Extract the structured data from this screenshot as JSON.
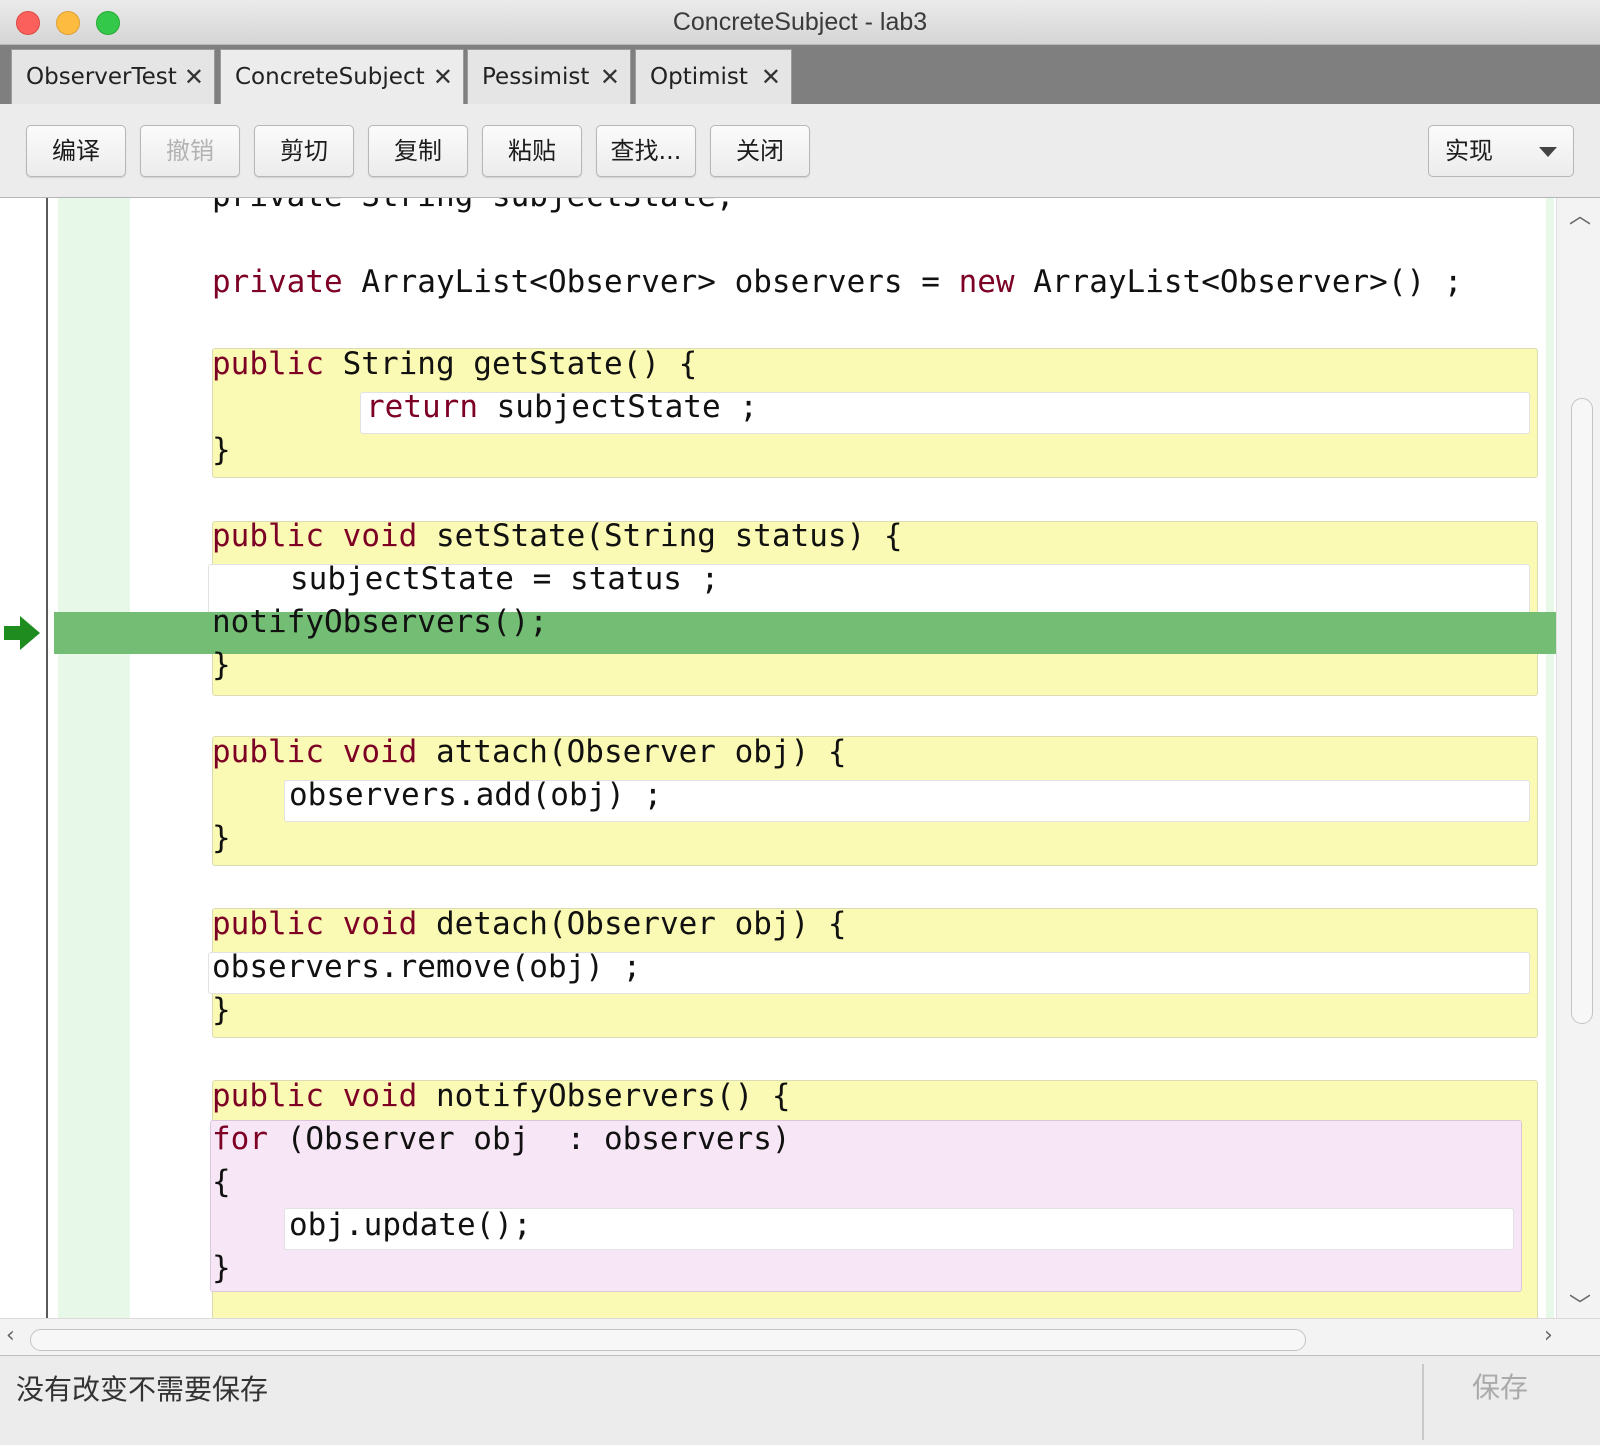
{
  "window": {
    "title": "ConcreteSubject - lab3"
  },
  "tabs": [
    {
      "label": "ObserverTest",
      "active": false
    },
    {
      "label": "ConcreteSubject",
      "active": true
    },
    {
      "label": "Pessimist",
      "active": false
    },
    {
      "label": "Optimist",
      "active": false
    }
  ],
  "toolbar": {
    "compile": "编译",
    "undo": "撤销",
    "cut": "剪切",
    "copy": "复制",
    "paste": "粘贴",
    "find": "查找...",
    "close": "关闭",
    "view_selected": "实现"
  },
  "code": {
    "l0": "private String subjectState;",
    "l1_kw": "private",
    "l1_rest": " ArrayList<Observer> observers = ",
    "l1_kw2": "new",
    "l1_tail": " ArrayList<Observer>() ;",
    "gs_kw": "public",
    "gs_rest": " String getState() {",
    "gs_ret_kw": "return",
    "gs_ret_rest": " subjectState ;",
    "close_brace": "}",
    "ss_kw": "public",
    "ss_kw2": "void",
    "ss_rest": " setState(String status) {",
    "ss_body1": "subjectState = status ;",
    "ss_body2": "notifyObservers();",
    "at_kw": "public",
    "at_kw2": "void",
    "at_rest": " attach(Observer obj) {",
    "at_body": "observers.add(obj) ;",
    "de_kw": "public",
    "de_kw2": "void",
    "de_rest": " detach(Observer obj) {",
    "de_body": "observers.remove(obj) ;",
    "no_kw": "public",
    "no_kw2": "void",
    "no_rest": " notifyObservers() {",
    "for_kw": "for",
    "for_rest": " (Observer obj  : observers)",
    "open_brace": "{",
    "upd": "obj.update();"
  },
  "colors": {
    "keyword": "#7d0025",
    "exec_line": "#74bd74",
    "class_bg": "#fafab4",
    "loop_bg": "#f7e6f6"
  },
  "status": {
    "message": "没有改变不需要保存",
    "save": "保存"
  }
}
